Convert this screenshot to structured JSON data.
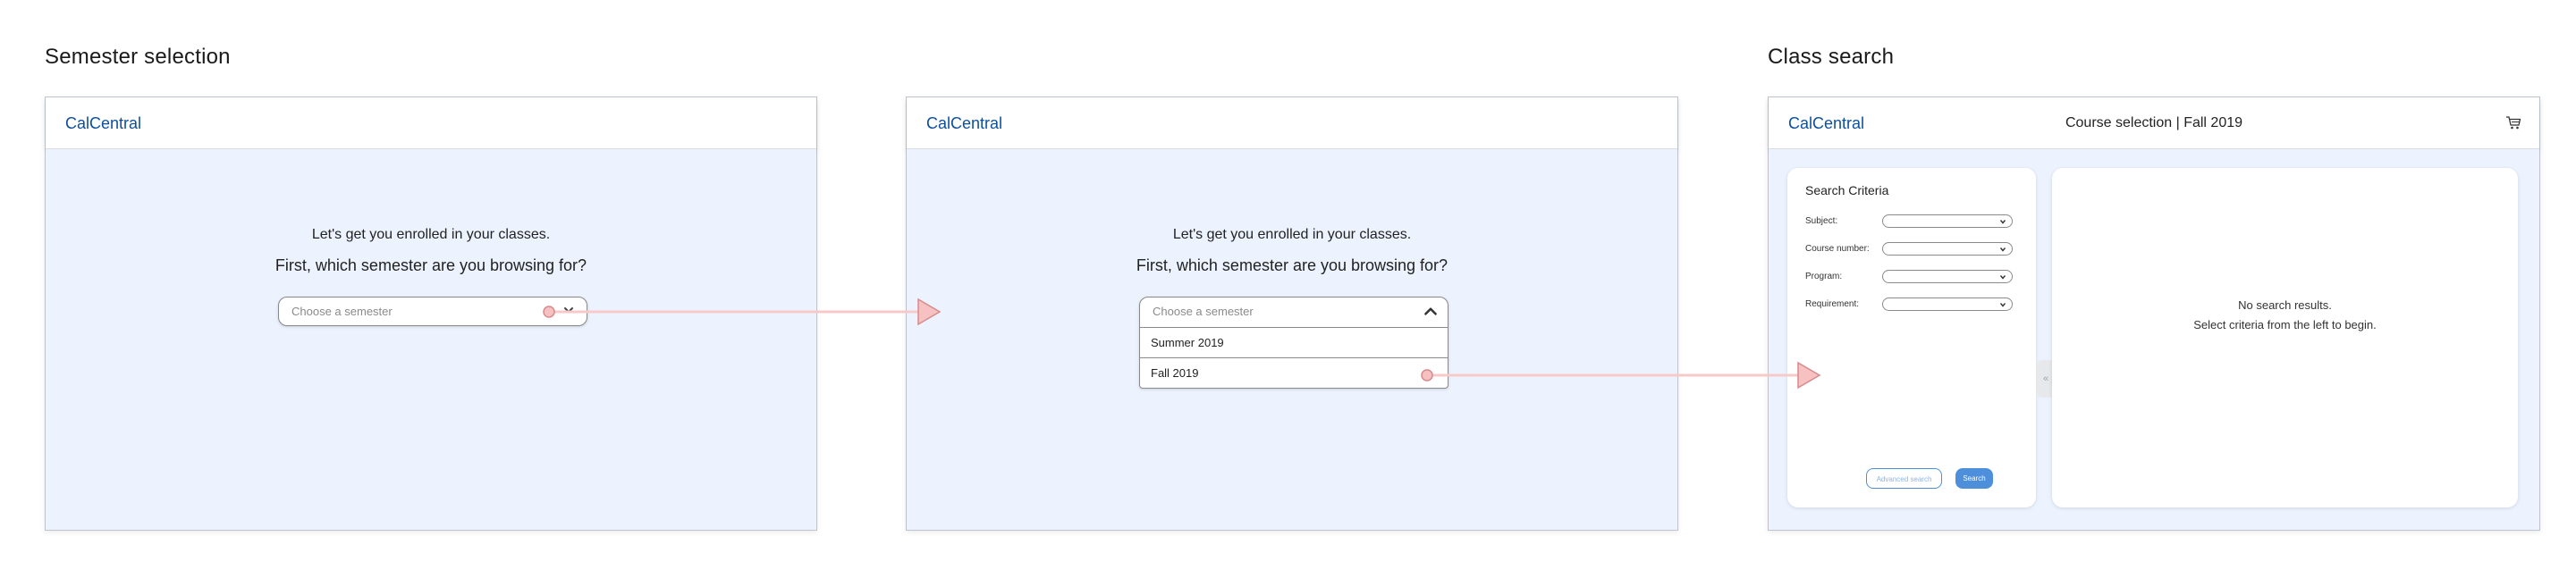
{
  "sections": {
    "semester_selection": "Semester selection",
    "class_search": "Class search"
  },
  "brand": "CalCentral",
  "enroll": {
    "prompt_line1": "Let's get you enrolled in your classes.",
    "prompt_line2": "First, which semester are you browsing for?",
    "semester_placeholder": "Choose a semester",
    "semester_options": [
      "Summer 2019",
      "Fall 2019"
    ]
  },
  "class_search": {
    "header_title": "Course selection | Fall 2019",
    "criteria_title": "Search Criteria",
    "criteria": [
      {
        "label": "Subject:"
      },
      {
        "label": "Course number:"
      },
      {
        "label": "Program:"
      },
      {
        "label": "Requirement:"
      }
    ],
    "advanced_search_label": "Advanced search",
    "search_label": "Search",
    "collapse_glyph": "«",
    "empty_line1": "No search results.",
    "empty_line2": "Select criteria from the left to begin."
  },
  "icons": {
    "chevron_down": "chevron-down-icon",
    "chevron_up": "chevron-up-icon",
    "cart": "cart-icon"
  },
  "colors": {
    "brand_blue": "#0d4f9c",
    "page_bg_blue": "#ecf3fe",
    "accent_button": "#4e8fdc",
    "flow_arrow": "#f4b8b8"
  }
}
